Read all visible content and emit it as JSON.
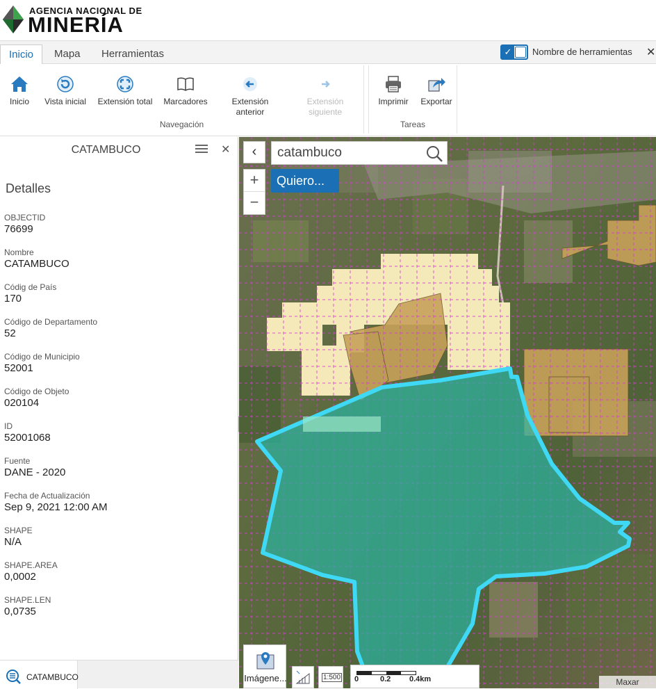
{
  "header": {
    "logo_line1": "AGENCIA NACIONAL DE",
    "logo_line2": "MINERÍA"
  },
  "tabs": [
    "Inicio",
    "Mapa",
    "Herramientas"
  ],
  "active_tab": "Inicio",
  "tool_names_toggle": {
    "label": "Nombre de herramientas",
    "checked": true
  },
  "ribbon": {
    "navigation_group": "Navegación",
    "tasks_group": "Tareas",
    "buttons": {
      "home": "Inicio",
      "initial_view": "Vista inicial",
      "full_extent": "Extensión total",
      "bookmarks": "Marcadores",
      "prev_extent_1": "Extensión",
      "prev_extent_2": "anterior",
      "next_extent_1": "Extensión",
      "next_extent_2": "siguiente",
      "print": "Imprimir",
      "export": "Exportar"
    }
  },
  "panel": {
    "title": "CATAMBUCO",
    "details_heading": "Detalles",
    "fields": [
      {
        "label": "OBJECTID",
        "value": "76699"
      },
      {
        "label": "Nombre",
        "value": "CATAMBUCO"
      },
      {
        "label": "Códig de País",
        "value": "170"
      },
      {
        "label": "Código de Departamento",
        "value": "52"
      },
      {
        "label": "Código de Municipio",
        "value": "52001"
      },
      {
        "label": "Código de Objeto",
        "value": "020104"
      },
      {
        "label": "ID",
        "value": "52001068"
      },
      {
        "label": "Fuente",
        "value": "DANE - 2020"
      },
      {
        "label": "Fecha de Actualización",
        "value": "Sep 9, 2021 12:00 AM"
      },
      {
        "label": "SHAPE",
        "value": "N/A"
      },
      {
        "label": "SHAPE.AREA",
        "value": "0,0002"
      },
      {
        "label": "SHAPE.LEN",
        "value": "0,0735"
      }
    ],
    "footer_tab": "CATAMBUCO"
  },
  "map": {
    "search_value": "catambuco",
    "quiero_label": "Quiero...",
    "basemap_label": "Imágene...",
    "scale_text_label": "1:500",
    "scale_ticks": [
      "0",
      "0.2",
      "0.4km"
    ],
    "attribution": "Maxar"
  },
  "colors": {
    "accent": "#1a6fb5",
    "selection_outline": "#3fd9f5",
    "selection_fill": "#2ab5a3",
    "grid_lines": "#d63bd6",
    "concession_light": "#fdf0c0",
    "concession_dark": "#c7a15a"
  }
}
